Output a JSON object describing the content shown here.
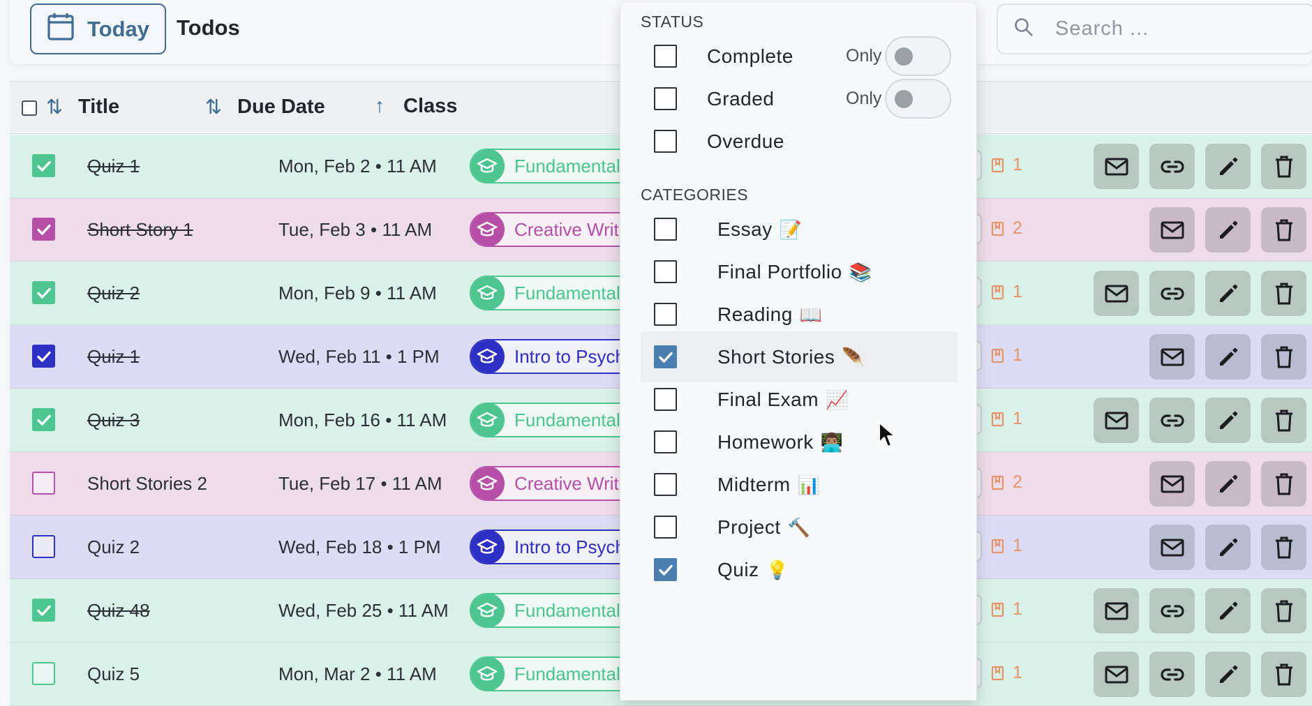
{
  "header": {
    "today_label": "Today",
    "title": "Todos",
    "search_placeholder": "Search ..."
  },
  "table": {
    "columns": [
      {
        "label": "Title",
        "sort": "both"
      },
      {
        "label": "Due Date",
        "sort": "both"
      },
      {
        "label": "Class",
        "sort": "asc"
      }
    ],
    "rows": [
      {
        "title": "Quiz 1",
        "due": "Mon, Feb 2 • 11 AM",
        "class": "Fundamentals",
        "color": "green",
        "done": true,
        "points": "1",
        "has_link": true
      },
      {
        "title": "Short Story 1",
        "due": "Tue, Feb 3 • 11 AM",
        "class": "Creative Writing",
        "color": "pink",
        "done": true,
        "points": "2",
        "has_link": false
      },
      {
        "title": "Quiz 2",
        "due": "Mon, Feb 9 • 11 AM",
        "class": "Fundamentals",
        "color": "green",
        "done": true,
        "points": "1",
        "has_link": true
      },
      {
        "title": "Quiz 1",
        "due": "Wed, Feb 11 • 1 PM",
        "class": "Intro to Psychology",
        "color": "blue",
        "done": true,
        "points": "1",
        "has_link": false
      },
      {
        "title": "Quiz 3",
        "due": "Mon, Feb 16 • 11 AM",
        "class": "Fundamentals",
        "color": "green",
        "done": true,
        "points": "1",
        "has_link": true
      },
      {
        "title": "Short Stories 2",
        "due": "Tue, Feb 17 • 11 AM",
        "class": "Creative Writing",
        "color": "pink",
        "done": false,
        "points": "2",
        "has_link": false
      },
      {
        "title": "Quiz 2",
        "due": "Wed, Feb 18 • 1 PM",
        "class": "Intro to Psychology",
        "color": "blue",
        "done": false,
        "points": "1",
        "has_link": false
      },
      {
        "title": "Quiz 48",
        "due": "Wed, Feb 25 • 11 AM",
        "class": "Fundamentals",
        "color": "green",
        "done": true,
        "points": "1",
        "has_link": true
      },
      {
        "title": "Quiz 5",
        "due": "Mon, Mar 2 • 11 AM",
        "class": "Fundamentals",
        "color": "green",
        "done": false,
        "points": "1",
        "has_link": true
      }
    ]
  },
  "colors": {
    "green": "#4cc58f",
    "pink": "#b64fa8",
    "blue": "#2e2fc4",
    "accent": "#3f6d94",
    "points": "#e5946a"
  },
  "filter": {
    "status_label": "STATUS",
    "only_label": "Only",
    "status": [
      {
        "label": "Complete",
        "checked": false,
        "has_only": true,
        "only_on": false
      },
      {
        "label": "Graded",
        "checked": false,
        "has_only": true,
        "only_on": false
      },
      {
        "label": "Overdue",
        "checked": false,
        "has_only": false
      }
    ],
    "categories_label": "CATEGORIES",
    "categories": [
      {
        "label": "Essay",
        "emoji": "📝",
        "checked": false
      },
      {
        "label": "Final Portfolio",
        "emoji": "📚",
        "checked": false
      },
      {
        "label": "Reading",
        "emoji": "📖",
        "checked": false
      },
      {
        "label": "Short Stories",
        "emoji": "🪶",
        "checked": true,
        "hover": true
      },
      {
        "label": "Final Exam",
        "emoji": "📈",
        "checked": false
      },
      {
        "label": "Homework",
        "emoji": "👨🏽‍💻",
        "checked": false
      },
      {
        "label": "Midterm",
        "emoji": "📊",
        "checked": false
      },
      {
        "label": "Project",
        "emoji": "🔨",
        "checked": false
      },
      {
        "label": "Quiz",
        "emoji": "💡",
        "checked": true
      }
    ]
  }
}
